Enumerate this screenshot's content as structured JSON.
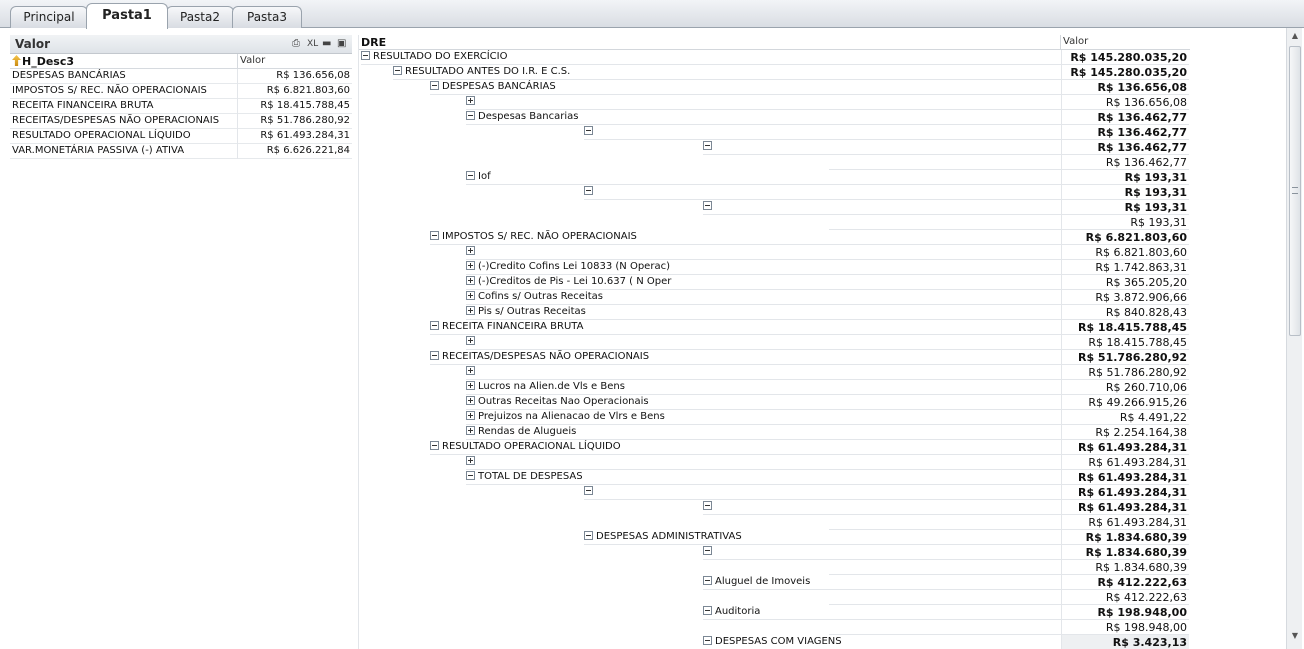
{
  "tabs": [
    {
      "label": "Principal",
      "active": false
    },
    {
      "label": "Pasta1",
      "active": true
    },
    {
      "label": "Pasta2",
      "active": false
    },
    {
      "label": "Pasta3",
      "active": false
    }
  ],
  "valor_box": {
    "title": "Valor",
    "icon_xl": "XL",
    "column_dimension": "H_Desc3",
    "column_value": "Valor",
    "rows": [
      {
        "name": "DESPESAS BANCÁRIAS",
        "value": "R$ 136.656,08"
      },
      {
        "name": "IMPOSTOS S/ REC. NÃO OPERACIONAIS",
        "value": "R$ 6.821.803,60"
      },
      {
        "name": "RECEITA FINANCEIRA BRUTA",
        "value": "R$ 18.415.788,45"
      },
      {
        "name": "RECEITAS/DESPESAS NÃO OPERACIONAIS",
        "value": "R$ 51.786.280,92"
      },
      {
        "name": "RESULTADO OPERACIONAL LÍQUIDO",
        "value": "R$ 61.493.284,31"
      },
      {
        "name": "VAR.MONETÁRIA PASSIVA (-) ATIVA",
        "value": "R$ 6.626.221,84"
      }
    ]
  },
  "dre": {
    "header_label": "DRE",
    "header_value": "Valor",
    "rows": [
      {
        "level": 0,
        "toggle": "minus",
        "label": "RESULTADO DO EXERCÍCIO",
        "value": "R$ 145.280.035,20",
        "bold": true
      },
      {
        "level": 1,
        "toggle": "minus",
        "label": "RESULTADO ANTES DO I.R. E C.S.",
        "value": "R$ 145.280.035,20",
        "bold": true
      },
      {
        "level": 2,
        "toggle": "minus",
        "label": "DESPESAS BANCÁRIAS",
        "value": "R$ 136.656,08",
        "bold": true
      },
      {
        "level": 3,
        "toggle": "plus",
        "label": "",
        "value": "R$ 136.656,08",
        "bold": false
      },
      {
        "level": 3,
        "toggle": "minus",
        "label": "Despesas Bancarias",
        "value": "R$ 136.462,77",
        "bold": true
      },
      {
        "level": 4,
        "toggle": "minus",
        "label": "",
        "value": "R$ 136.462,77",
        "bold": true
      },
      {
        "level": 5,
        "toggle": "minus",
        "label": "",
        "value": "R$ 136.462,77",
        "bold": true
      },
      {
        "level": 6,
        "toggle": "",
        "label": "",
        "value": "R$ 136.462,77",
        "bold": false
      },
      {
        "level": 3,
        "toggle": "minus",
        "label": "Iof",
        "value": "R$ 193,31",
        "bold": true
      },
      {
        "level": 4,
        "toggle": "minus",
        "label": "",
        "value": "R$ 193,31",
        "bold": true
      },
      {
        "level": 5,
        "toggle": "minus",
        "label": "",
        "value": "R$ 193,31",
        "bold": true
      },
      {
        "level": 6,
        "toggle": "",
        "label": "",
        "value": "R$ 193,31",
        "bold": false
      },
      {
        "level": 2,
        "toggle": "minus",
        "label": "IMPOSTOS S/ REC. NÃO OPERACIONAIS",
        "value": "R$ 6.821.803,60",
        "bold": true
      },
      {
        "level": 3,
        "toggle": "plus",
        "label": "",
        "value": "R$ 6.821.803,60",
        "bold": false
      },
      {
        "level": 3,
        "toggle": "plus",
        "label": "(-)Credito Cofins Lei 10833 (N Operac)",
        "value": "R$ 1.742.863,31",
        "bold": false
      },
      {
        "level": 3,
        "toggle": "plus",
        "label": "(-)Creditos de Pis - Lei 10.637 ( N Oper",
        "value": "R$ 365.205,20",
        "bold": false
      },
      {
        "level": 3,
        "toggle": "plus",
        "label": "Cofins s/ Outras Receitas",
        "value": "R$ 3.872.906,66",
        "bold": false
      },
      {
        "level": 3,
        "toggle": "plus",
        "label": "Pis s/ Outras Receitas",
        "value": "R$ 840.828,43",
        "bold": false
      },
      {
        "level": 2,
        "toggle": "minus",
        "label": "RECEITA FINANCEIRA BRUTA",
        "value": "R$ 18.415.788,45",
        "bold": true
      },
      {
        "level": 3,
        "toggle": "plus",
        "label": "",
        "value": "R$ 18.415.788,45",
        "bold": false
      },
      {
        "level": 2,
        "toggle": "minus",
        "label": "RECEITAS/DESPESAS NÃO OPERACIONAIS",
        "value": "R$ 51.786.280,92",
        "bold": true
      },
      {
        "level": 3,
        "toggle": "plus",
        "label": "",
        "value": "R$ 51.786.280,92",
        "bold": false
      },
      {
        "level": 3,
        "toggle": "plus",
        "label": "Lucros na Alien.de Vls e Bens",
        "value": "R$ 260.710,06",
        "bold": false
      },
      {
        "level": 3,
        "toggle": "plus",
        "label": "Outras Receitas Nao Operacionais",
        "value": "R$ 49.266.915,26",
        "bold": false
      },
      {
        "level": 3,
        "toggle": "plus",
        "label": "Prejuizos na Alienacao de Vlrs e Bens",
        "value": "R$ 4.491,22",
        "bold": false
      },
      {
        "level": 3,
        "toggle": "plus",
        "label": "Rendas de Alugueis",
        "value": "R$ 2.254.164,38",
        "bold": false
      },
      {
        "level": 2,
        "toggle": "minus",
        "label": "RESULTADO OPERACIONAL LÍQUIDO",
        "value": "R$ 61.493.284,31",
        "bold": true
      },
      {
        "level": 3,
        "toggle": "plus",
        "label": "",
        "value": "R$ 61.493.284,31",
        "bold": false
      },
      {
        "level": 3,
        "toggle": "minus",
        "label": "TOTAL DE DESPESAS",
        "value": "R$ 61.493.284,31",
        "bold": true
      },
      {
        "level": 4,
        "toggle": "minus",
        "label": "",
        "value": "R$ 61.493.284,31",
        "bold": true
      },
      {
        "level": 5,
        "toggle": "minus",
        "label": "",
        "value": "R$ 61.493.284,31",
        "bold": true
      },
      {
        "level": 6,
        "toggle": "",
        "label": "",
        "value": "R$ 61.493.284,31",
        "bold": false
      },
      {
        "level": 4,
        "toggle": "minus",
        "label": "DESPESAS ADMINISTRATIVAS",
        "value": "R$ 1.834.680,39",
        "bold": true
      },
      {
        "level": 5,
        "toggle": "minus",
        "label": "",
        "value": "R$ 1.834.680,39",
        "bold": true
      },
      {
        "level": 6,
        "toggle": "",
        "label": "",
        "value": "R$ 1.834.680,39",
        "bold": false
      },
      {
        "level": 5,
        "toggle": "minus",
        "label": "Aluguel de Imoveis",
        "value": "R$ 412.222,63",
        "bold": true
      },
      {
        "level": 6,
        "toggle": "",
        "label": "",
        "value": "R$ 412.222,63",
        "bold": false
      },
      {
        "level": 5,
        "toggle": "minus",
        "label": "Auditoria",
        "value": "R$ 198.948,00",
        "bold": true
      },
      {
        "level": 6,
        "toggle": "",
        "label": "",
        "value": "R$ 198.948,00",
        "bold": false
      },
      {
        "level": 5,
        "toggle": "minus",
        "label": "DESPESAS COM VIAGENS",
        "value": "R$ 3.423,13",
        "bold": true,
        "shade": true
      }
    ]
  }
}
